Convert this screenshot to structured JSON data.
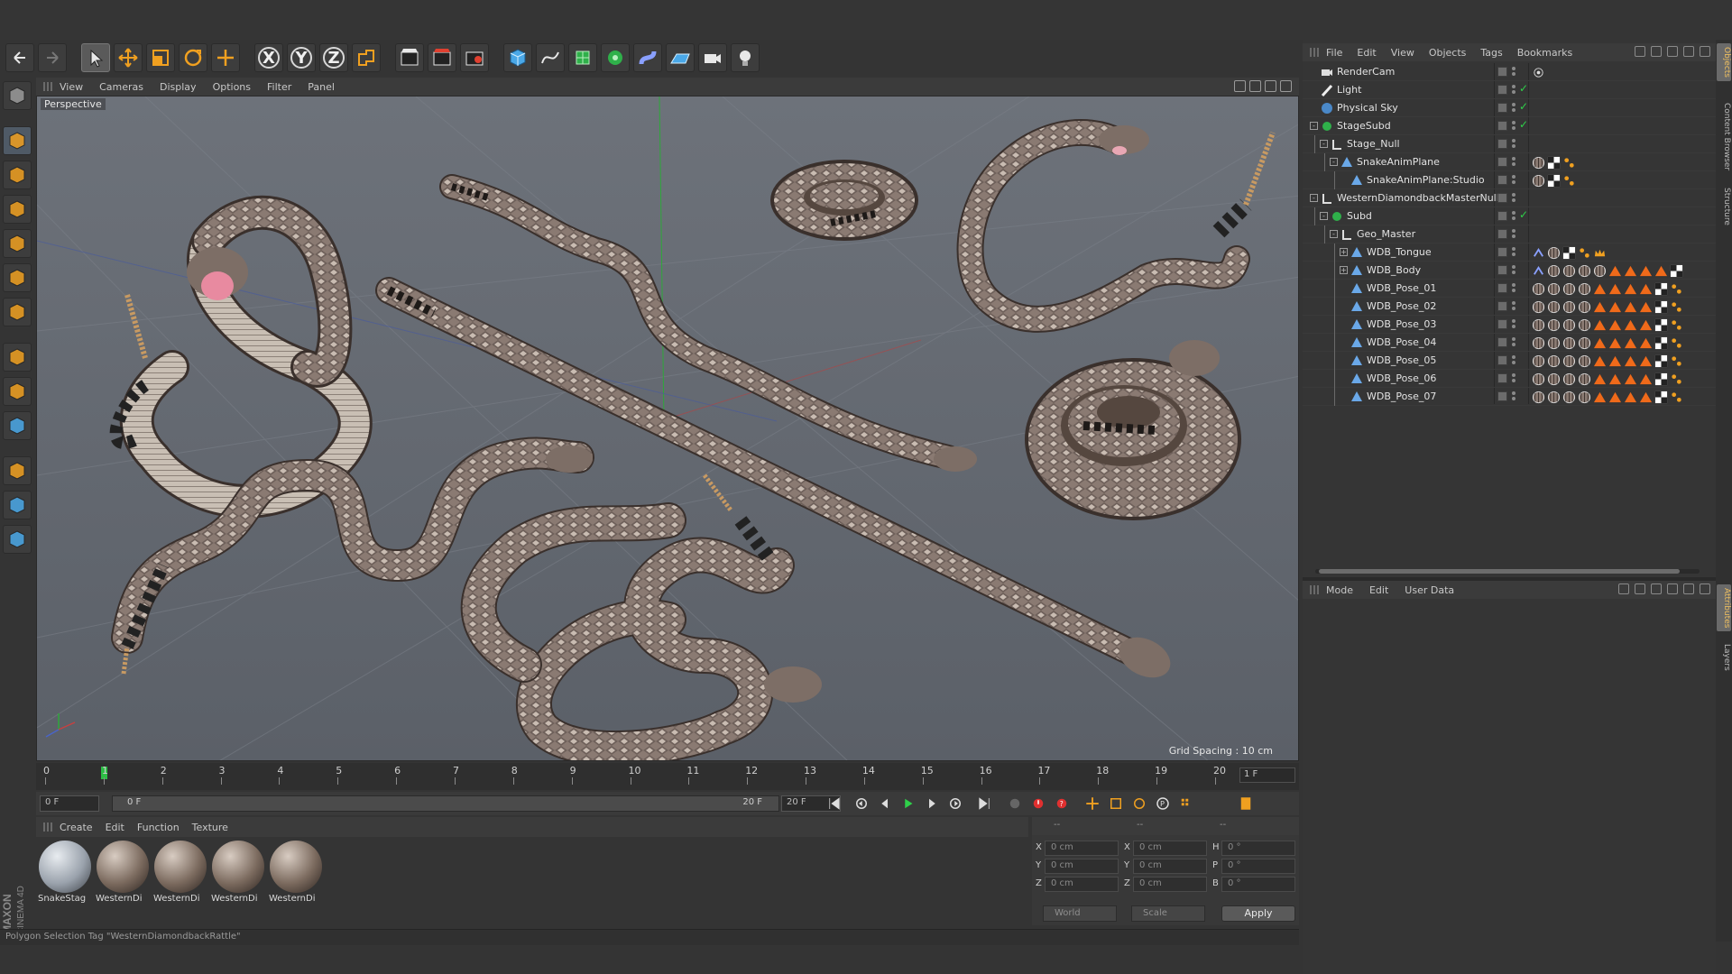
{
  "toolbar": {
    "undo": "undo-icon",
    "redo": "redo-icon",
    "items": [
      {
        "name": "live-selection-icon",
        "selected": true
      },
      {
        "name": "move-icon",
        "selected": false
      },
      {
        "name": "scale-icon",
        "selected": false
      },
      {
        "name": "rotate-icon",
        "selected": false
      },
      {
        "name": "recent-tool-icon",
        "selected": false
      }
    ],
    "axis": [
      "X",
      "Y",
      "Z"
    ],
    "coord_system": "world-coordinates-icon",
    "render": [
      "render-view-icon",
      "render-picture-viewer-icon",
      "edit-render-settings-icon"
    ],
    "create": [
      "cube-icon",
      "spline-pen-icon",
      "subdivision-surface-icon",
      "cloner-icon",
      "deformer-icon",
      "floor-icon",
      "camera-icon",
      "light-icon"
    ]
  },
  "left_tools": [
    "make-editable-icon",
    "model-mode-icon",
    "texture-mode-icon",
    "workplane-mode-icon",
    "points-mode-icon",
    "edges-mode-icon",
    "polygons-mode-icon",
    "axis-mode-icon",
    "tweak-mode-icon",
    "solo-icon",
    "snap-icon",
    "workplane-lock-icon",
    "grid-snap-icon"
  ],
  "viewport": {
    "menu": [
      "View",
      "Cameras",
      "Display",
      "Options",
      "Filter",
      "Panel"
    ],
    "label": "Perspective",
    "grid_spacing": "Grid Spacing : 10 cm",
    "axis_labels": [
      "X",
      "Y",
      "Z"
    ]
  },
  "timeline": {
    "ticks": [
      "0",
      "1",
      "2",
      "3",
      "4",
      "5",
      "6",
      "7",
      "8",
      "9",
      "10",
      "11",
      "12",
      "13",
      "14",
      "15",
      "16",
      "17",
      "18",
      "19",
      "20"
    ],
    "current_frame": 1,
    "current_frame_display": "1 F",
    "start_field": "0 F",
    "range_start": "0 F",
    "range_end": "20 F",
    "end_field": "20 F"
  },
  "materials": {
    "menu": [
      "Create",
      "Edit",
      "Function",
      "Texture"
    ],
    "items": [
      {
        "name": "SnakeStag",
        "color": "#9aa2ac"
      },
      {
        "name": "WesternDi",
        "color": "#7b6a5e"
      },
      {
        "name": "WesternDi",
        "color": "#7b6a5e"
      },
      {
        "name": "WesternDi",
        "color": "#7b6a5e"
      },
      {
        "name": "WesternDi",
        "color": "#7b6a5e"
      }
    ]
  },
  "coordinates": {
    "headers": [
      "--",
      "--",
      "--"
    ],
    "rows": [
      {
        "label_pos": "X",
        "pos": "0 cm",
        "label_size": "X",
        "size": "0 cm",
        "label_rot": "H",
        "rot": "0 °"
      },
      {
        "label_pos": "Y",
        "pos": "0 cm",
        "label_size": "Y",
        "size": "0 cm",
        "label_rot": "P",
        "rot": "0 °"
      },
      {
        "label_pos": "Z",
        "pos": "0 cm",
        "label_size": "Z",
        "size": "0 cm",
        "label_rot": "B",
        "rot": "0 °"
      }
    ],
    "mode": "World",
    "size_mode": "Scale",
    "apply": "Apply"
  },
  "status": "Polygon Selection Tag \"WesternDiamondbackRattle\"",
  "object_manager": {
    "menu": [
      "File",
      "Edit",
      "View",
      "Objects",
      "Tags",
      "Bookmarks"
    ],
    "objects": [
      {
        "name": "RenderCam",
        "depth": 0,
        "icon": "camera-icon",
        "expand": "",
        "check": "",
        "tags": [
          "target-tag-icon"
        ]
      },
      {
        "name": "Light",
        "depth": 0,
        "icon": "light-icon",
        "expand": "",
        "check": "✓",
        "tags": []
      },
      {
        "name": "Physical Sky",
        "depth": 0,
        "icon": "sky-icon",
        "expand": "",
        "check": "✓",
        "tags": []
      },
      {
        "name": "StageSubd",
        "depth": 0,
        "icon": "subdivision-icon",
        "expand": "-",
        "check": "✓",
        "tags": []
      },
      {
        "name": "Stage_Null",
        "depth": 1,
        "icon": "null-icon",
        "expand": "-",
        "check": "",
        "tags": []
      },
      {
        "name": "SnakeAnimPlane",
        "depth": 2,
        "icon": "polygon-icon",
        "expand": "-",
        "check": "",
        "tags": [
          "material-tag-icon",
          "checker-tag-icon",
          "selection-tag-icon"
        ]
      },
      {
        "name": "SnakeAnimPlane:Studio",
        "depth": 3,
        "icon": "polygon-icon",
        "expand": "",
        "check": "",
        "tags": [
          "material-tag-icon",
          "checker-tag-icon",
          "selection-tag-icon"
        ]
      },
      {
        "name": "WesternDiamondbackMasterNull",
        "depth": 0,
        "icon": "null-icon",
        "expand": "-",
        "check": "",
        "tags": []
      },
      {
        "name": "Subd",
        "depth": 1,
        "icon": "subdivision-icon",
        "expand": "-",
        "check": "✓",
        "tags": []
      },
      {
        "name": "Geo_Master",
        "depth": 2,
        "icon": "null-icon",
        "expand": "-",
        "check": "",
        "tags": []
      },
      {
        "name": "WDB_Tongue",
        "depth": 3,
        "icon": "polygon-icon",
        "expand": "+",
        "check": "",
        "tags": [
          "weight-tag-icon",
          "material-tag-icon",
          "checker-tag-icon",
          "selection-tag-icon",
          "crown-tag-icon"
        ]
      },
      {
        "name": "WDB_Body",
        "depth": 3,
        "icon": "polygon-icon",
        "expand": "+",
        "check": "",
        "tags": [
          "weight-tag-icon",
          "material-tag-icon",
          "material-tag-icon",
          "material-tag-icon",
          "material-tag-icon",
          "triangle-tag-icon",
          "triangle-tag-icon",
          "triangle-tag-icon",
          "triangle-tag-icon",
          "checker-tag-icon"
        ]
      },
      {
        "name": "WDB_Pose_01",
        "depth": 3,
        "icon": "polygon-icon",
        "expand": "",
        "check": "",
        "tags": [
          "material-tag-icon",
          "material-tag-icon",
          "material-tag-icon",
          "material-tag-icon",
          "triangle-tag-icon",
          "triangle-tag-icon",
          "triangle-tag-icon",
          "triangle-tag-icon",
          "checker-tag-icon",
          "selection-tag-icon"
        ]
      },
      {
        "name": "WDB_Pose_02",
        "depth": 3,
        "icon": "polygon-icon",
        "expand": "",
        "check": "",
        "tags": [
          "material-tag-icon",
          "material-tag-icon",
          "material-tag-icon",
          "material-tag-icon",
          "triangle-tag-icon",
          "triangle-tag-icon",
          "triangle-tag-icon",
          "triangle-tag-icon",
          "checker-tag-icon",
          "selection-tag-icon"
        ]
      },
      {
        "name": "WDB_Pose_03",
        "depth": 3,
        "icon": "polygon-icon",
        "expand": "",
        "check": "",
        "tags": [
          "material-tag-icon",
          "material-tag-icon",
          "material-tag-icon",
          "material-tag-icon",
          "triangle-tag-icon",
          "triangle-tag-icon",
          "triangle-tag-icon",
          "triangle-tag-icon",
          "checker-tag-icon",
          "selection-tag-icon"
        ]
      },
      {
        "name": "WDB_Pose_04",
        "depth": 3,
        "icon": "polygon-icon",
        "expand": "",
        "check": "",
        "tags": [
          "material-tag-icon",
          "material-tag-icon",
          "material-tag-icon",
          "material-tag-icon",
          "triangle-tag-icon",
          "triangle-tag-icon",
          "triangle-tag-icon",
          "triangle-tag-icon",
          "checker-tag-icon",
          "selection-tag-icon"
        ]
      },
      {
        "name": "WDB_Pose_05",
        "depth": 3,
        "icon": "polygon-icon",
        "expand": "",
        "check": "",
        "tags": [
          "material-tag-icon",
          "material-tag-icon",
          "material-tag-icon",
          "material-tag-icon",
          "triangle-tag-icon",
          "triangle-tag-icon",
          "triangle-tag-icon",
          "triangle-tag-icon",
          "checker-tag-icon",
          "selection-tag-icon"
        ]
      },
      {
        "name": "WDB_Pose_06",
        "depth": 3,
        "icon": "polygon-icon",
        "expand": "",
        "check": "",
        "tags": [
          "material-tag-icon",
          "material-tag-icon",
          "material-tag-icon",
          "material-tag-icon",
          "triangle-tag-icon",
          "triangle-tag-icon",
          "triangle-tag-icon",
          "triangle-tag-icon",
          "checker-tag-icon",
          "selection-tag-icon"
        ]
      },
      {
        "name": "WDB_Pose_07",
        "depth": 3,
        "icon": "polygon-icon",
        "expand": "",
        "check": "",
        "tags": [
          "material-tag-icon",
          "material-tag-icon",
          "material-tag-icon",
          "material-tag-icon",
          "triangle-tag-icon",
          "triangle-tag-icon",
          "triangle-tag-icon",
          "triangle-tag-icon",
          "checker-tag-icon",
          "selection-tag-icon"
        ]
      }
    ]
  },
  "attributes": {
    "menu": [
      "Mode",
      "Edit",
      "User Data"
    ]
  },
  "side_tabs": [
    {
      "label": "Objects",
      "active": true
    },
    {
      "label": "Content Browser",
      "active": false
    },
    {
      "label": "Structure",
      "active": false
    },
    {
      "label": "Attributes",
      "active": true
    },
    {
      "label": "Layers",
      "active": false
    }
  ],
  "brand": {
    "line1": "MAXON",
    "line2": "CINEMA 4D"
  },
  "colors": {
    "accent_orange": "#f0a020",
    "check_green": "#2fd04a",
    "frame_marker": "#2dbd45",
    "tag_triangle": "#f06a1a",
    "snake_base": "#8a7a72",
    "snake_dark": "#4a3e3a",
    "snake_light": "#d8cfc6"
  }
}
